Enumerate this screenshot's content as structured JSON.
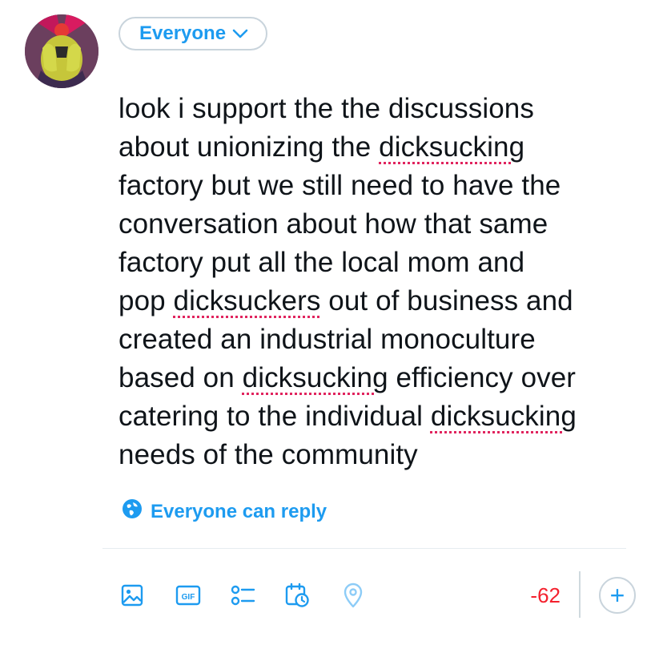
{
  "compose": {
    "audience_label": "Everyone",
    "lines": [
      [
        {
          "text": "look i support the the discussions"
        }
      ],
      [
        {
          "text": "about unionizing the "
        },
        {
          "text": "dicksucking",
          "spell": true
        }
      ],
      [
        {
          "text": "factory but we still need to have the"
        }
      ],
      [
        {
          "text": "conversation about how that same"
        }
      ],
      [
        {
          "text": "factory put all the local mom and"
        }
      ],
      [
        {
          "text": "pop "
        },
        {
          "text": "dicksuckers",
          "spell": true
        },
        {
          "text": " out of business and"
        }
      ],
      [
        {
          "text": "created an industrial monoculture"
        }
      ],
      [
        {
          "text": "based on "
        },
        {
          "text": "dicksucking",
          "spell": true
        },
        {
          "text": " efficiency over"
        }
      ],
      [
        {
          "text": "catering to the individual "
        },
        {
          "text": "dicksucking",
          "spell": true
        }
      ],
      [
        {
          "text": "needs of the community"
        }
      ]
    ],
    "reply_setting": "Everyone can reply"
  },
  "toolbar": {
    "icons": [
      "image-icon",
      "gif-icon",
      "poll-icon",
      "schedule-icon",
      "location-icon"
    ],
    "gif_text": "GIF",
    "char_count": "-62",
    "add_label": "+"
  },
  "colors": {
    "accent": "#1d9bf0",
    "over_limit": "#f4212e",
    "text": "#0f1419",
    "spellcheck": "#e0245e"
  }
}
